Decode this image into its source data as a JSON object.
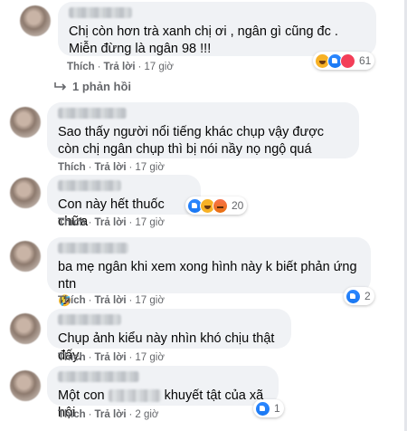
{
  "actions": {
    "like": "Thích",
    "reply": "Trả lời",
    "sep": "·"
  },
  "comments": [
    {
      "text": "Chị còn hơn trà xanh chị ơi , ngân gì cũng đc . Miễn đừng là ngân 98 !!!",
      "time": "17 giờ",
      "reactions": [
        "haha",
        "like",
        "heart"
      ],
      "count": "61"
    },
    {
      "text": "Sao thấy người nổi tiếng khác chụp vậy được còn chị ngân chụp thì bị nói nầy nọ ngộ quá",
      "time": "17 giờ"
    },
    {
      "text": "Con này hết thuốc chữa",
      "time": "17 giờ",
      "reactions": [
        "like",
        "haha",
        "angry"
      ],
      "count": "20"
    },
    {
      "text": "ba mẹ ngân khi xem xong hình này k biết phản ứng ntn",
      "time": "17 giờ",
      "reactions": [
        "like"
      ],
      "count": "2",
      "emoji": "🤣"
    },
    {
      "text": "Chụp ảnh kiểu này nhìn khó chịu thật đấy.",
      "time": "17 giờ"
    },
    {
      "text_before": "Một con",
      "text_after": "khuyết tật của xã hội",
      "time": "2 giờ",
      "reactions": [
        "like"
      ],
      "count": "1"
    }
  ],
  "replies_label": "1 phản hồi"
}
